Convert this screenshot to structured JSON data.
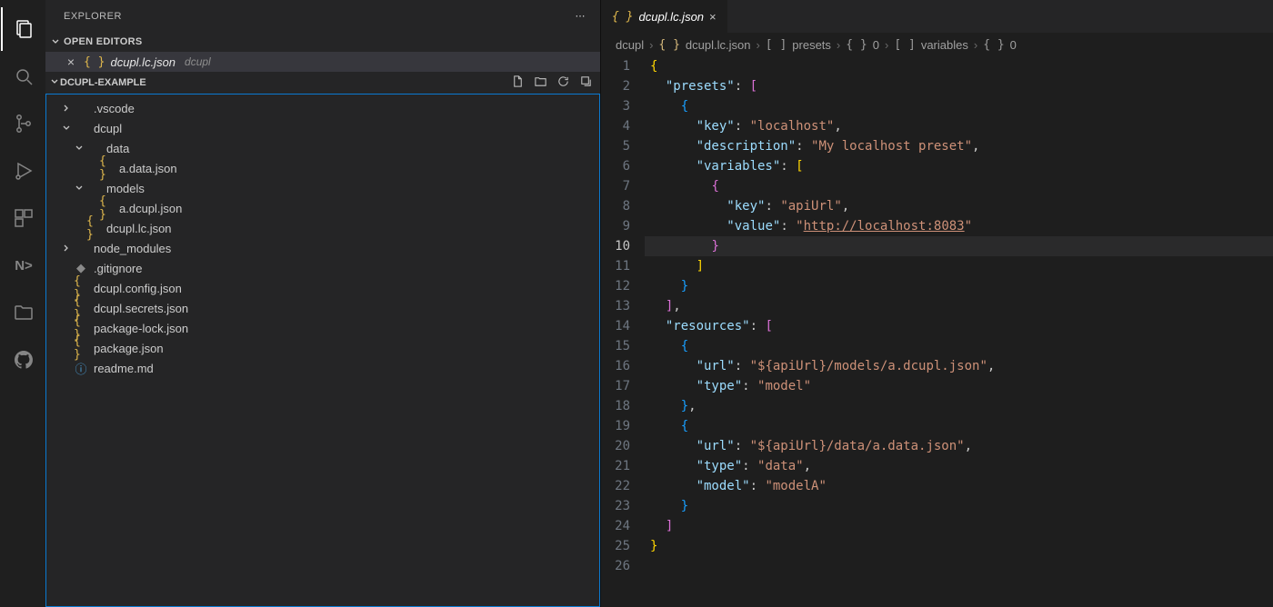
{
  "sidebar": {
    "title": "EXPLORER",
    "openEditors": {
      "header": "OPEN EDITORS",
      "items": [
        {
          "name": "dcupl.lc.json",
          "path": "dcupl"
        }
      ]
    },
    "project": {
      "name": "DCUPL-EXAMPLE"
    },
    "tree": [
      {
        "label": ".vscode",
        "kind": "folder",
        "expanded": false,
        "indent": 0
      },
      {
        "label": "dcupl",
        "kind": "folder",
        "expanded": true,
        "indent": 0
      },
      {
        "label": "data",
        "kind": "folder",
        "expanded": true,
        "indent": 1
      },
      {
        "label": "a.data.json",
        "kind": "json",
        "indent": 2
      },
      {
        "label": "models",
        "kind": "folder",
        "expanded": true,
        "indent": 1
      },
      {
        "label": "a.dcupl.json",
        "kind": "json",
        "indent": 2
      },
      {
        "label": "dcupl.lc.json",
        "kind": "json",
        "indent": 1
      },
      {
        "label": "node_modules",
        "kind": "folder",
        "expanded": false,
        "indent": 0
      },
      {
        "label": ".gitignore",
        "kind": "git",
        "indent": 0
      },
      {
        "label": "dcupl.config.json",
        "kind": "json",
        "indent": 0
      },
      {
        "label": "dcupl.secrets.json",
        "kind": "json",
        "indent": 0
      },
      {
        "label": "package-lock.json",
        "kind": "json",
        "indent": 0
      },
      {
        "label": "package.json",
        "kind": "json",
        "indent": 0
      },
      {
        "label": "readme.md",
        "kind": "info",
        "indent": 0
      }
    ]
  },
  "editor": {
    "tab": {
      "name": "dcupl.lc.json"
    },
    "breadcrumb": [
      "dcupl",
      "dcupl.lc.json",
      "presets",
      "0",
      "variables",
      "0"
    ],
    "lineCount": 26,
    "currentLine": 10,
    "content": {
      "presets": [
        {
          "key": "localhost",
          "description": "My localhost preset",
          "variables": [
            {
              "key": "apiUrl",
              "value": "http://localhost:8083"
            }
          ]
        }
      ],
      "resources": [
        {
          "url": "${apiUrl}/models/a.dcupl.json",
          "type": "model"
        },
        {
          "url": "${apiUrl}/data/a.data.json",
          "type": "data",
          "model": "modelA"
        }
      ]
    }
  }
}
